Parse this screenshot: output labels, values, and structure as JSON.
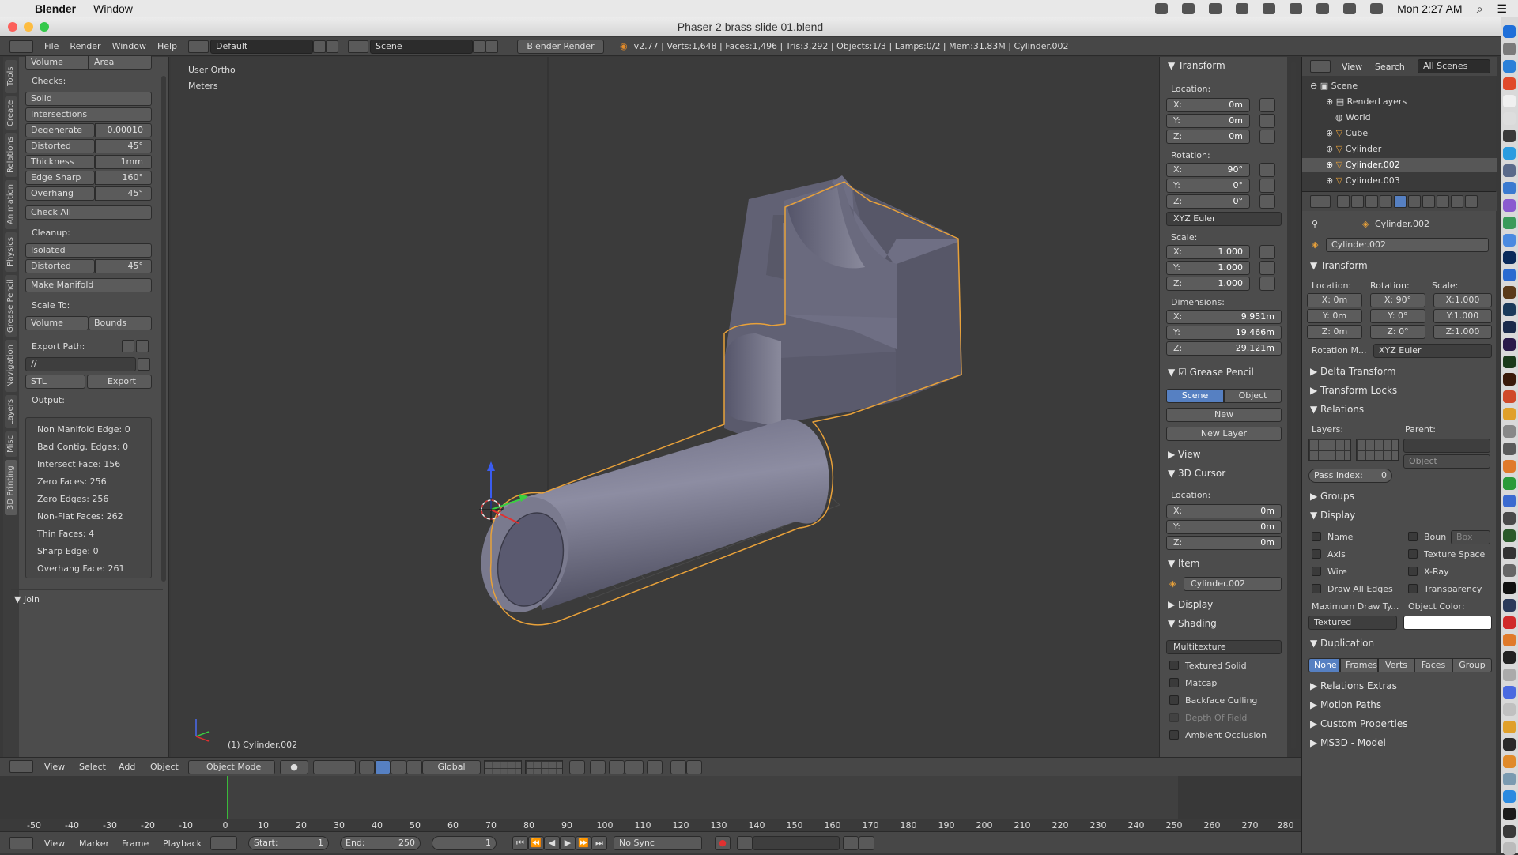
{
  "mac_menubar": {
    "app": "Blender",
    "menu": [
      "Window"
    ],
    "clock": "Mon 2:27 AM"
  },
  "window": {
    "title": "Phaser 2 brass slide 01.blend"
  },
  "info_header": {
    "menus": [
      "File",
      "Render",
      "Window",
      "Help"
    ],
    "layout": "Default",
    "scene": "Scene",
    "engine": "Blender Render",
    "stats": "v2.77 | Verts:1,648 | Faces:1,496 | Tris:3,292 | Objects:1/3 | Lamps:0/2 | Mem:31.83M | Cylinder.002"
  },
  "tool_tabs": [
    "Tools",
    "Create",
    "Relations",
    "Animation",
    "Physics",
    "Grease Pencil",
    "Navigation",
    "Layers",
    "Misc",
    "3D Printing"
  ],
  "toolshelf": {
    "volume": "Volume",
    "area": "Area",
    "checks_label": "Checks:",
    "solid": "Solid",
    "intersections": "Intersections",
    "degenerate": {
      "label": "Degenerate",
      "value": "0.00010"
    },
    "distorted": {
      "label": "Distorted",
      "value": "45°"
    },
    "thickness": {
      "label": "Thickness",
      "value": "1mm"
    },
    "edge_sharp": {
      "label": "Edge Sharp",
      "value": "160°"
    },
    "overhang": {
      "label": "Overhang",
      "value": "45°"
    },
    "check_all": "Check All",
    "cleanup_label": "Cleanup:",
    "isolated": "Isolated",
    "distorted2": {
      "label": "Distorted",
      "value": "45°"
    },
    "make_manifold": "Make Manifold",
    "scale_to_label": "Scale To:",
    "scale_volume": "Volume",
    "scale_bounds": "Bounds",
    "export_path_label": "Export Path:",
    "export_path": "//",
    "format": "STL",
    "export": "Export",
    "output_label": "Output:",
    "output": [
      "Non Manifold Edge: 0",
      "Bad Contig. Edges: 0",
      "Intersect Face: 156",
      "Zero Faces: 256",
      "Zero Edges: 256",
      "Non-Flat Faces: 262",
      "Thin Faces: 4",
      "Sharp Edge: 0",
      "Overhang Face: 261"
    ],
    "join": "Join"
  },
  "viewport": {
    "view": "User Ortho",
    "units": "Meters",
    "object": "(1) Cylinder.002"
  },
  "npanel": {
    "transform": "Transform",
    "location_label": "Location:",
    "loc": [
      {
        "l": "X:",
        "v": "0m"
      },
      {
        "l": "Y:",
        "v": "0m"
      },
      {
        "l": "Z:",
        "v": "0m"
      }
    ],
    "rotation_label": "Rotation:",
    "rot": [
      {
        "l": "X:",
        "v": "90°"
      },
      {
        "l": "Y:",
        "v": "0°"
      },
      {
        "l": "Z:",
        "v": "0°"
      }
    ],
    "rot_mode": "XYZ Euler",
    "scale_label": "Scale:",
    "scale": [
      {
        "l": "X:",
        "v": "1.000"
      },
      {
        "l": "Y:",
        "v": "1.000"
      },
      {
        "l": "Z:",
        "v": "1.000"
      }
    ],
    "dimensions_label": "Dimensions:",
    "dims": [
      {
        "l": "X:",
        "v": "9.951m"
      },
      {
        "l": "Y:",
        "v": "19.466m"
      },
      {
        "l": "Z:",
        "v": "29.121m"
      }
    ],
    "grease_pencil": "Grease Pencil",
    "gp_scene": "Scene",
    "gp_object": "Object",
    "gp_new": "New",
    "gp_new_layer": "New Layer",
    "view": "View",
    "cursor": "3D Cursor",
    "cursor_loc_label": "Location:",
    "cursor_loc": [
      {
        "l": "X:",
        "v": "0m"
      },
      {
        "l": "Y:",
        "v": "0m"
      },
      {
        "l": "Z:",
        "v": "0m"
      }
    ],
    "item": "Item",
    "item_name": "Cylinder.002",
    "display": "Display",
    "shading": "Shading",
    "shading_mode": "Multitexture",
    "shading_opts": [
      "Textured Solid",
      "Matcap",
      "Backface Culling",
      "Depth Of Field",
      "Ambient Occlusion"
    ]
  },
  "outliner": {
    "menus": [
      "View",
      "Search"
    ],
    "filter": "All Scenes",
    "items": [
      "Scene",
      "RenderLayers",
      "World",
      "Cube",
      "Cylinder",
      "Cylinder.002",
      "Cylinder.003"
    ]
  },
  "properties": {
    "breadcrumb": "Cylinder.002",
    "name": "Cylinder.002",
    "transform": "Transform",
    "loc_label": "Location:",
    "rot_label": "Rotation:",
    "scale_label": "Scale:",
    "loc": [
      "X: 0m",
      "Y: 0m",
      "Z: 0m"
    ],
    "rot": [
      "X: 90°",
      "Y: 0°",
      "Z: 0°"
    ],
    "scale": [
      "X:1.000",
      "Y:1.000",
      "Z:1.000"
    ],
    "rotation_mode_label": "Rotation M...",
    "rotation_mode": "XYZ Euler",
    "delta": "Delta Transform",
    "locks": "Transform Locks",
    "relations": "Relations",
    "layers_label": "Layers:",
    "parent_label": "Parent:",
    "parent_type": "Object",
    "pass_index": "Pass Index:",
    "pass_value": "0",
    "groups": "Groups",
    "display": "Display",
    "disp_left": [
      "Name",
      "Axis",
      "Wire",
      "Draw All Edges"
    ],
    "disp_right": [
      "Boun",
      "Texture Space",
      "X-Ray",
      "Transparency"
    ],
    "bounds_type": "Box",
    "max_draw_label": "Maximum Draw Ty...",
    "object_color_label": "Object Color:",
    "max_draw": "Textured",
    "duplication": "Duplication",
    "dup_tabs": [
      "None",
      "Frames",
      "Verts",
      "Faces",
      "Group"
    ],
    "collapsed": [
      "Relations Extras",
      "Motion Paths",
      "Custom Properties",
      "MS3D - Model"
    ]
  },
  "viewport_header": {
    "menus": [
      "View",
      "Select",
      "Add",
      "Object"
    ],
    "mode": "Object Mode",
    "orientation": "Global"
  },
  "timeline": {
    "ticks": [
      "-50",
      "-40",
      "-30",
      "-20",
      "-10",
      "0",
      "10",
      "20",
      "30",
      "40",
      "50",
      "60",
      "70",
      "80",
      "90",
      "100",
      "110",
      "120",
      "130",
      "140",
      "150",
      "160",
      "170",
      "180",
      "190",
      "200",
      "210",
      "220",
      "230",
      "240",
      "250",
      "260",
      "270",
      "280"
    ],
    "menus": [
      "View",
      "Marker",
      "Frame",
      "Playback"
    ],
    "start": "Start:",
    "start_val": "1",
    "end": "End:",
    "end_val": "250",
    "current": "1",
    "sync": "No Sync"
  },
  "colors": {
    "accent": "#5680c2",
    "selection": "#f5a623",
    "bg": "#393939"
  }
}
